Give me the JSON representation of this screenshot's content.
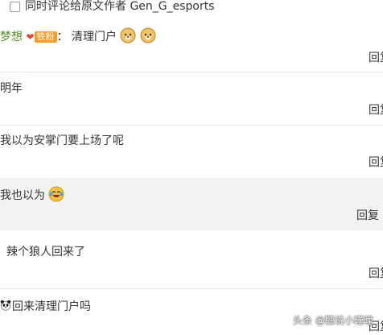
{
  "option_checkbox": {
    "label": "同时评论给原文作者 Gen_G_esports",
    "checked": false
  },
  "comments": [
    {
      "user": "梦想",
      "badge": "铁粉",
      "sep": "：",
      "text": "清理门户",
      "reply": "回复",
      "emojis": [
        "doge-icon",
        "doge-icon"
      ]
    },
    {
      "text": "明年",
      "reply": "回复"
    },
    {
      "text": "我以为安掌门要上场了呢",
      "reply": "回复"
    },
    {
      "text": "我也以为",
      "reply": "回复",
      "emojis": [
        "laughing-crying-icon"
      ]
    },
    {
      "text": "辣个狼人回来了",
      "reply": "回复"
    },
    {
      "text": "回来清理门户吗",
      "reply": "回复",
      "emojis": [
        "panda-icon"
      ]
    }
  ],
  "watermark": "头条 @聽说小瑾曈",
  "colors": {
    "highlight_bg": "#f2f2f2",
    "username": "#5a8f2a",
    "badge": "#f39c2b",
    "separator": "#e6e6e6"
  }
}
